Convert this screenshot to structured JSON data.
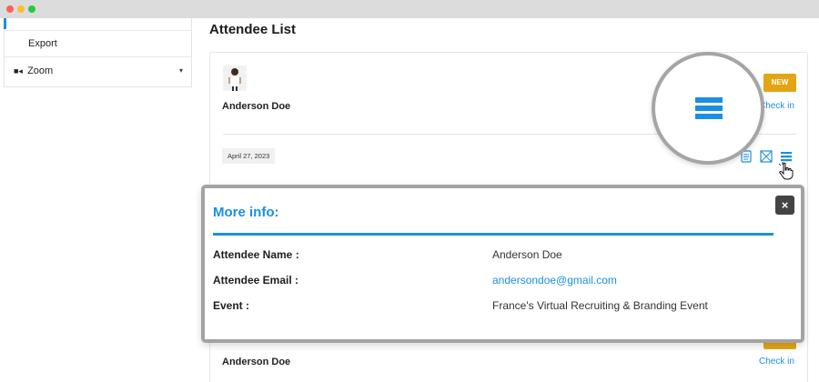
{
  "sidebar": {
    "items": [
      {
        "label": "Export",
        "icon": "none"
      },
      {
        "label": "Zoom",
        "icon": "video-camera-icon",
        "caret": "▾"
      }
    ]
  },
  "main": {
    "title": "Attendee List",
    "attendee": {
      "name": "Anderson Doe",
      "badge": "NEW",
      "checkin_label": "Check in",
      "date": "April 27, 2023"
    },
    "next_attendee": {
      "name": "Anderson Doe",
      "checkin_label": "Check in"
    }
  },
  "modal": {
    "title": "More info:",
    "close_label": "×",
    "rows": [
      {
        "label": "Attendee Name :",
        "value": "Anderson Doe"
      },
      {
        "label": "Attendee Email :",
        "value": "andersondoe@gmail.com"
      },
      {
        "label": "Event :",
        "value": "France's Virtual Recruiting & Branding Event"
      }
    ]
  },
  "colors": {
    "accent": "#1a8fe3",
    "badge": "#e3a514",
    "close_button": "#444444"
  }
}
